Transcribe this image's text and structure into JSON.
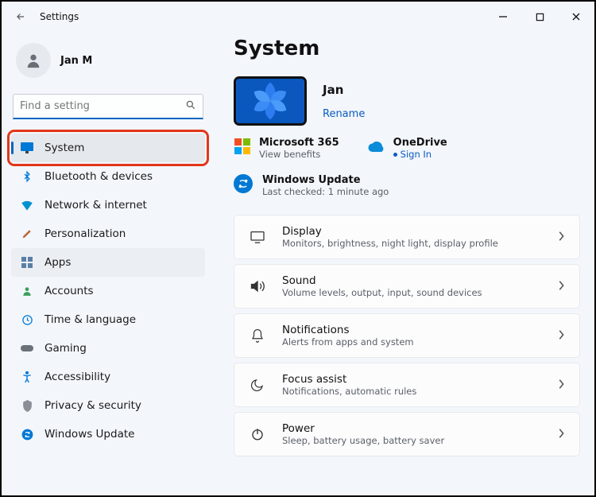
{
  "window": {
    "title": "Settings"
  },
  "user": {
    "name": "Jan M"
  },
  "search": {
    "placeholder": "Find a setting"
  },
  "sidebar": {
    "items": [
      {
        "label": "System",
        "selected": true,
        "highlighted": true
      },
      {
        "label": "Bluetooth & devices"
      },
      {
        "label": "Network & internet"
      },
      {
        "label": "Personalization"
      },
      {
        "label": "Apps",
        "hover": true
      },
      {
        "label": "Accounts"
      },
      {
        "label": "Time & language"
      },
      {
        "label": "Gaming"
      },
      {
        "label": "Accessibility"
      },
      {
        "label": "Privacy & security"
      },
      {
        "label": "Windows Update"
      }
    ]
  },
  "page": {
    "title": "System",
    "device": {
      "name": "Jan",
      "rename": "Rename"
    },
    "tiles": {
      "ms365": {
        "title": "Microsoft 365",
        "sub": "View benefits"
      },
      "onedrive": {
        "title": "OneDrive",
        "sub": "Sign In"
      }
    },
    "update": {
      "title": "Windows Update",
      "sub": "Last checked: 1 minute ago"
    },
    "cards": [
      {
        "title": "Display",
        "sub": "Monitors, brightness, night light, display profile"
      },
      {
        "title": "Sound",
        "sub": "Volume levels, output, input, sound devices"
      },
      {
        "title": "Notifications",
        "sub": "Alerts from apps and system"
      },
      {
        "title": "Focus assist",
        "sub": "Notifications, automatic rules"
      },
      {
        "title": "Power",
        "sub": "Sleep, battery usage, battery saver"
      }
    ]
  }
}
